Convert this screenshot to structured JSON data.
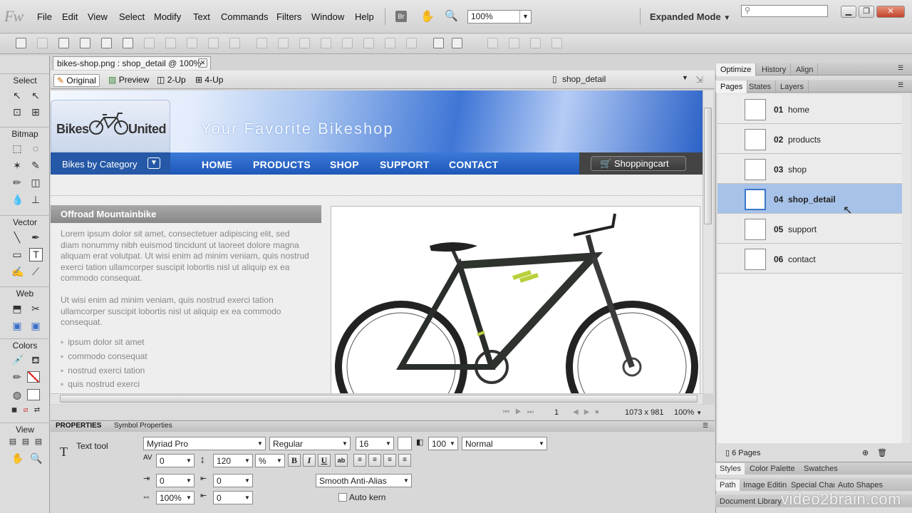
{
  "app": {
    "logo": "Fw",
    "menus": [
      "File",
      "Edit",
      "View",
      "Select",
      "Modify",
      "Text",
      "Commands",
      "Filters",
      "Window",
      "Help"
    ],
    "br_label": "Br",
    "zoom": "100%",
    "workspace_mode": "Expanded Mode"
  },
  "document": {
    "tab_title": "bikes-shop.png : shop_detail @ 100%",
    "views": [
      "Original",
      "Preview",
      "2-Up",
      "4-Up"
    ],
    "active_view": "Original",
    "current_page": "shop_detail"
  },
  "tools": {
    "sections": [
      "Select",
      "Bitmap",
      "Vector",
      "Web",
      "Colors",
      "View"
    ]
  },
  "site": {
    "logo_left": "Bikes",
    "logo_right": "United",
    "slogan": "Your Favorite Bikeshop",
    "category": "Bikes by Category",
    "nav": [
      "HOME",
      "PRODUCTS",
      "SHOP",
      "SUPPORT",
      "CONTACT"
    ],
    "cart": "Shoppingcart",
    "section_title": "Offroad Mountainbike",
    "para1": "Lorem ipsum dolor sit amet, consectetuer adipiscing elit, sed diam nonummy nibh euismod tincidunt ut laoreet dolore magna aliquam erat volutpat. Ut wisi enim ad minim veniam, quis nostrud exerci tation ullamcorper suscipit lobortis nisl ut aliquip ex ea commodo consequat.",
    "para2": "Ut wisi enim ad minim veniam, quis nostrud exerci tation ullamcorper suscipit lobortis nisl ut aliquip ex ea commodo consequat.",
    "bullets": [
      "ipsum dolor sit amet",
      "commodo consequat",
      "nostrud exerci tation",
      "quis nostrud exerci"
    ]
  },
  "status": {
    "frame": "1",
    "dimensions": "1073 x 981",
    "zoom": "100%"
  },
  "properties": {
    "tabs": [
      "PROPERTIES",
      "Symbol Properties"
    ],
    "tool_name": "Text tool",
    "font": "Myriad Pro",
    "style": "Regular",
    "size": "16",
    "opacity": "100",
    "blend": "Normal",
    "kerning": "0",
    "leading": "120",
    "leading_unit": "%",
    "bold": "B",
    "italic": "I",
    "underline": "U",
    "indent": "0",
    "space_before": "0",
    "horiz_scale": "100%",
    "space_after": "0",
    "anti_alias": "Smooth Anti-Alias",
    "auto_kern": "Auto kern"
  },
  "right_panel": {
    "top_tabs": [
      "Optimize",
      "History",
      "Align"
    ],
    "sub_tabs": [
      "Pages",
      "States",
      "Layers"
    ],
    "pages": [
      {
        "num": "01",
        "name": "home"
      },
      {
        "num": "02",
        "name": "products"
      },
      {
        "num": "03",
        "name": "shop"
      },
      {
        "num": "04",
        "name": "shop_detail"
      },
      {
        "num": "05",
        "name": "support"
      },
      {
        "num": "06",
        "name": "contact"
      }
    ],
    "selected_page": "shop_detail",
    "pages_count": "6 Pages",
    "bottom_tabs1": [
      "Styles",
      "Color Palette",
      "Swatches"
    ],
    "bottom_tabs2": [
      "Path",
      "Image Editing",
      "Special Chars",
      "Auto Shapes"
    ],
    "bottom_tabs3": [
      "Document Library"
    ],
    "watermark": "video2brain.com"
  },
  "colors": {
    "nav_blue": "#1e57b8",
    "selection": "#a7c2e8"
  }
}
